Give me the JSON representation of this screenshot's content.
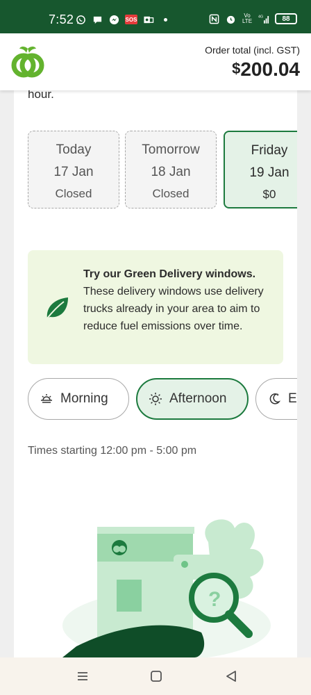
{
  "status_bar": {
    "time": "7:52",
    "sos_label": "SOS",
    "network": "4G",
    "battery": "88"
  },
  "header": {
    "order_total_label": "Order total (incl. GST)",
    "currency_symbol": "$",
    "order_total_amount": "200.04"
  },
  "content": {
    "previous_text": "hour.",
    "days": [
      {
        "day": "Today",
        "date": "17 Jan",
        "status": "Closed",
        "selected": false
      },
      {
        "day": "Tomorrow",
        "date": "18 Jan",
        "status": "Closed",
        "selected": false
      },
      {
        "day": "Friday",
        "date": "19 Jan",
        "status": "$0",
        "selected": true
      }
    ],
    "green_delivery": {
      "title": "Try our Green Delivery windows.",
      "body": "These delivery windows use delivery trucks already in your area to aim to reduce fuel emissions over time."
    },
    "time_tabs": [
      {
        "label": "Morning",
        "icon": "sunrise-icon",
        "active": false
      },
      {
        "label": "Afternoon",
        "icon": "sun-icon",
        "active": true
      },
      {
        "label": "Ev",
        "icon": "moon-icon",
        "active": false
      }
    ],
    "times_text": "Times starting 12:00 pm - 5:00 pm"
  },
  "colors": {
    "brand_dark": "#17572e",
    "brand_green": "#1c7a3e",
    "green_box": "#eff7e1",
    "selected_bg": "#e4f2e7"
  }
}
